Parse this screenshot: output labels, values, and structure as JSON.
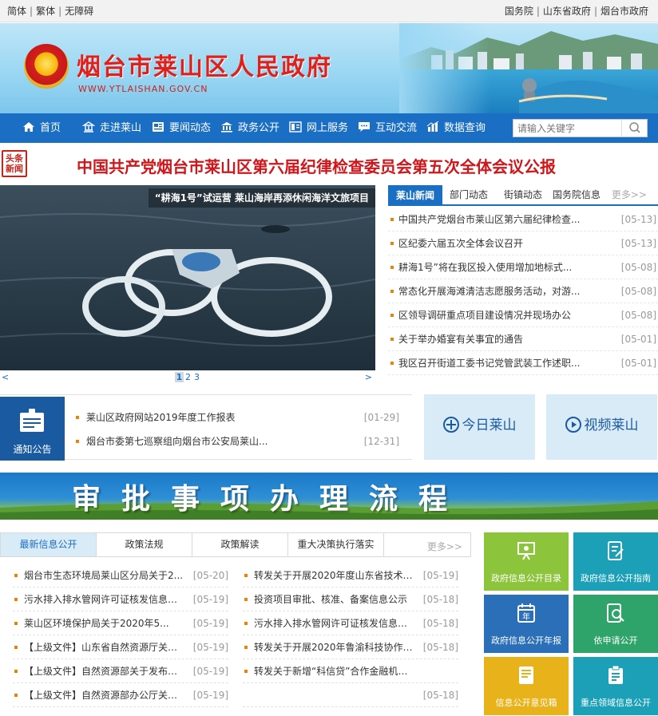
{
  "topbar": {
    "left_links": [
      "简体",
      "繁体",
      "无障碍"
    ],
    "right_links": [
      "国务院",
      "山东省政府",
      "烟台市政府"
    ]
  },
  "banner": {
    "title": "烟台市莱山区人民政府",
    "url": "WWW.YTLAISHAN.GOV.CN"
  },
  "nav": {
    "items": [
      {
        "label": "首页",
        "icon": "home-icon"
      },
      {
        "label": "走进莱山",
        "icon": "building-icon"
      },
      {
        "label": "要闻动态",
        "icon": "news-icon"
      },
      {
        "label": "政务公开",
        "icon": "government-icon"
      },
      {
        "label": "网上服务",
        "icon": "service-icon"
      },
      {
        "label": "互动交流",
        "icon": "chat-icon"
      },
      {
        "label": "数据查询",
        "icon": "chart-icon"
      }
    ],
    "search_placeholder": "请输入关键字"
  },
  "headline": {
    "badge": "头条新闻",
    "text": "中国共产党烟台市莱山区第六届纪律检查委员会第五次全体会议公报"
  },
  "slider": {
    "caption": "“耕海1号”试运营 莱山海岸再添休闲海洋文旅项目",
    "prev": "<",
    "next": ">",
    "pages": [
      "1",
      "2",
      "3"
    ],
    "active_page": "1"
  },
  "news_tabs": {
    "tabs": [
      "莱山新闻",
      "部门动态",
      "街镇动态",
      "国务院信息"
    ],
    "more": "更多>>"
  },
  "news_list": [
    {
      "title": "中国共产党烟台市莱山区第六届纪律检查...",
      "date": "[05-13]"
    },
    {
      "title": "区纪委六届五次全体会议召开",
      "date": "[05-13]"
    },
    {
      "title": "耕海1号”将在我区投入使用增加地标式...",
      "date": "[05-08]"
    },
    {
      "title": "常态化开展海滩清洁志愿服务活动，对游...",
      "date": "[05-08]"
    },
    {
      "title": "区领导调研重点项目建设情况并现场办公",
      "date": "[05-08]"
    },
    {
      "title": "关于举办婚宴有关事宜的通告",
      "date": "[05-01]"
    },
    {
      "title": "我区召开街道工委书记党管武装工作述职...",
      "date": "[05-01]"
    }
  ],
  "notice": {
    "label": "通知公告",
    "items": [
      {
        "title": "莱山区政府网站2019年度工作报表",
        "date": "[01-29]"
      },
      {
        "title": "烟台市委第七巡察组向烟台市公安局莱山...",
        "date": "[12-31]"
      }
    ]
  },
  "quick_buttons": {
    "today": "今日莱山",
    "video": "视频莱山"
  },
  "approve_banner": "审批事项办理流程",
  "info_tabs": {
    "tabs": [
      "最新信息公开",
      "政策法规",
      "政策解读",
      "重大决策执行落实"
    ],
    "more": "更多>>"
  },
  "info_list_left": [
    {
      "title": "烟台市生态环境局莱山区分局关于2...",
      "date": "[05-20]"
    },
    {
      "title": "污水排入排水管网许可证核发信息公...",
      "date": "[05-19]"
    },
    {
      "title": "莱山区环境保护局关于2020年5...",
      "date": "[05-19]"
    },
    {
      "title": "【上级文件】山东省自然资源厅关于...",
      "date": "[05-19]"
    },
    {
      "title": "【上级文件】自然资源部关于发布《...",
      "date": "[05-19]"
    },
    {
      "title": "【上级文件】自然资源部办公厅关于...",
      "date": "[05-19]"
    }
  ],
  "info_list_right": [
    {
      "title": "转发关于开展2020年度山东省技术市...",
      "date": "[05-19]"
    },
    {
      "title": "投资项目审批、核准、备案信息公示",
      "date": "[05-18]"
    },
    {
      "title": "污水排入排水管网许可证核发信息公示",
      "date": "[05-18]"
    },
    {
      "title": "转发关于开展2020年鲁渝科技协作计...",
      "date": "[05-18]"
    },
    {
      "title": "转发关于新增“科信贷”合作金融机构的...",
      "date": ""
    },
    {
      "title": "",
      "date": "[05-18]"
    }
  ],
  "tiles": [
    {
      "label": "政府信息公开目录",
      "color": "#8cc43c"
    },
    {
      "label": "政府信息公开指南",
      "color": "#1ba0b8"
    },
    {
      "label": "政府信息公开年报",
      "color": "#2a6fb8"
    },
    {
      "label": "依申请公开",
      "color": "#2ea36a"
    },
    {
      "label": "信息公开意见箱",
      "color": "#e8b21a"
    },
    {
      "label": "重点领域信息公开",
      "color": "#1ba0b8"
    }
  ]
}
